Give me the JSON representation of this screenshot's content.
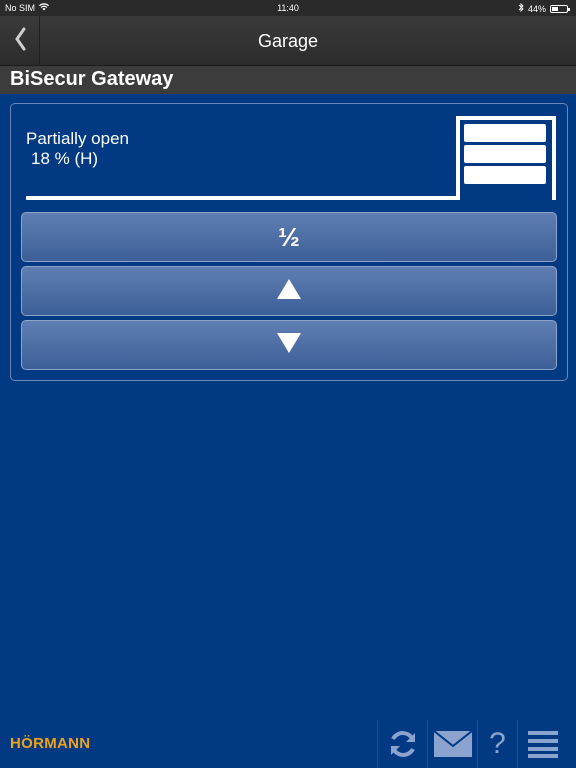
{
  "status_bar": {
    "carrier": "No SIM",
    "time": "11:40",
    "battery_percent": "44%",
    "battery_level": 0.44,
    "icons": [
      "wifi-icon",
      "bluetooth-icon",
      "battery-icon"
    ]
  },
  "nav": {
    "title": "Garage",
    "back_icon": "chevron-left-icon"
  },
  "gateway": {
    "title": "BiSecur Gateway"
  },
  "door": {
    "state": "Partially open",
    "value": "18 % (H)",
    "icon": "garage-door-icon"
  },
  "buttons": {
    "half": "½",
    "up_icon": "triangle-up-icon",
    "down_icon": "triangle-down-icon"
  },
  "footer": {
    "brand": "HÖRMANN",
    "tools": [
      "refresh-icon",
      "mail-icon",
      "help-icon",
      "menu-icon"
    ],
    "help_label": "?"
  },
  "colors": {
    "background": "#013a82",
    "brand": "#f0a11a",
    "header": "#3c3c3c"
  }
}
